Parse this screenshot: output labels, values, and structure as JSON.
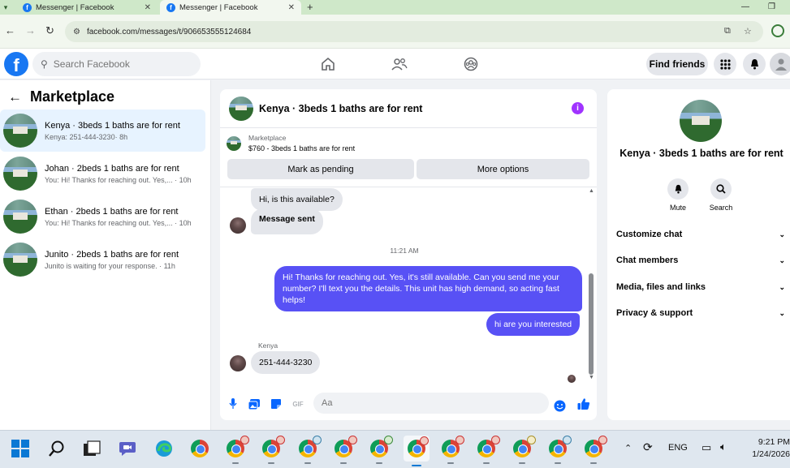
{
  "browser": {
    "tabs": [
      {
        "label": "Messenger | Facebook"
      },
      {
        "label": "Messenger | Facebook"
      }
    ],
    "url": "facebook.com/messages/t/906653555124684"
  },
  "fbnav": {
    "search_placeholder": "Search Facebook",
    "find_friends": "Find friends"
  },
  "left": {
    "title": "Marketplace",
    "conversations": [
      {
        "title": "Kenya · 3beds 1 baths are for rent",
        "subtitle": "Kenya: 251-444-3230· 8h"
      },
      {
        "title": "Johan · 2beds 1 baths are for rent",
        "subtitle": "You: Hi! Thanks for reaching out. Yes,... · 10h"
      },
      {
        "title": "Ethan · 2beds 1 baths are for rent",
        "subtitle": "You: Hi! Thanks for reaching out. Yes,... · 10h"
      },
      {
        "title": "Junito · 2beds 1 baths are for rent",
        "subtitle": "Junito is waiting for your response. · 11h"
      }
    ]
  },
  "chat": {
    "title": "Kenya · 3beds 1 baths are for rent",
    "info_glyph": "i",
    "marketplace_label": "Marketplace",
    "listing": "$760 - 3beds 1 baths are for rent",
    "mark_pending": "Mark as pending",
    "more_options": "More options",
    "messages": {
      "in1": "Hi, is this available?",
      "in2": "Message sent",
      "timestamp": "11:21 AM",
      "out1": "Hi! Thanks for reaching out. Yes, it's still available. Can you send me your number? I'll text you the details. This unit has high demand, so acting fast helps!",
      "out2": "hi are you interested",
      "sender": "Kenya",
      "in3": "251-444-3230"
    },
    "composer_placeholder": "Aa",
    "gif_label": "GIF"
  },
  "right": {
    "title": "Kenya · 3beds 1 baths are for rent",
    "mute": "Mute",
    "search": "Search",
    "sections": [
      "Customize chat",
      "Chat members",
      "Media, files and links",
      "Privacy & support"
    ]
  },
  "taskbar": {
    "lang": "ENG",
    "time": "9:21 PM",
    "date": "1/24/2026"
  },
  "colors": {
    "fb_blue": "#1877f2",
    "outgoing_bubble": "#5851f5",
    "info_purple": "#a033ff",
    "active_conv": "#e7f3ff"
  }
}
